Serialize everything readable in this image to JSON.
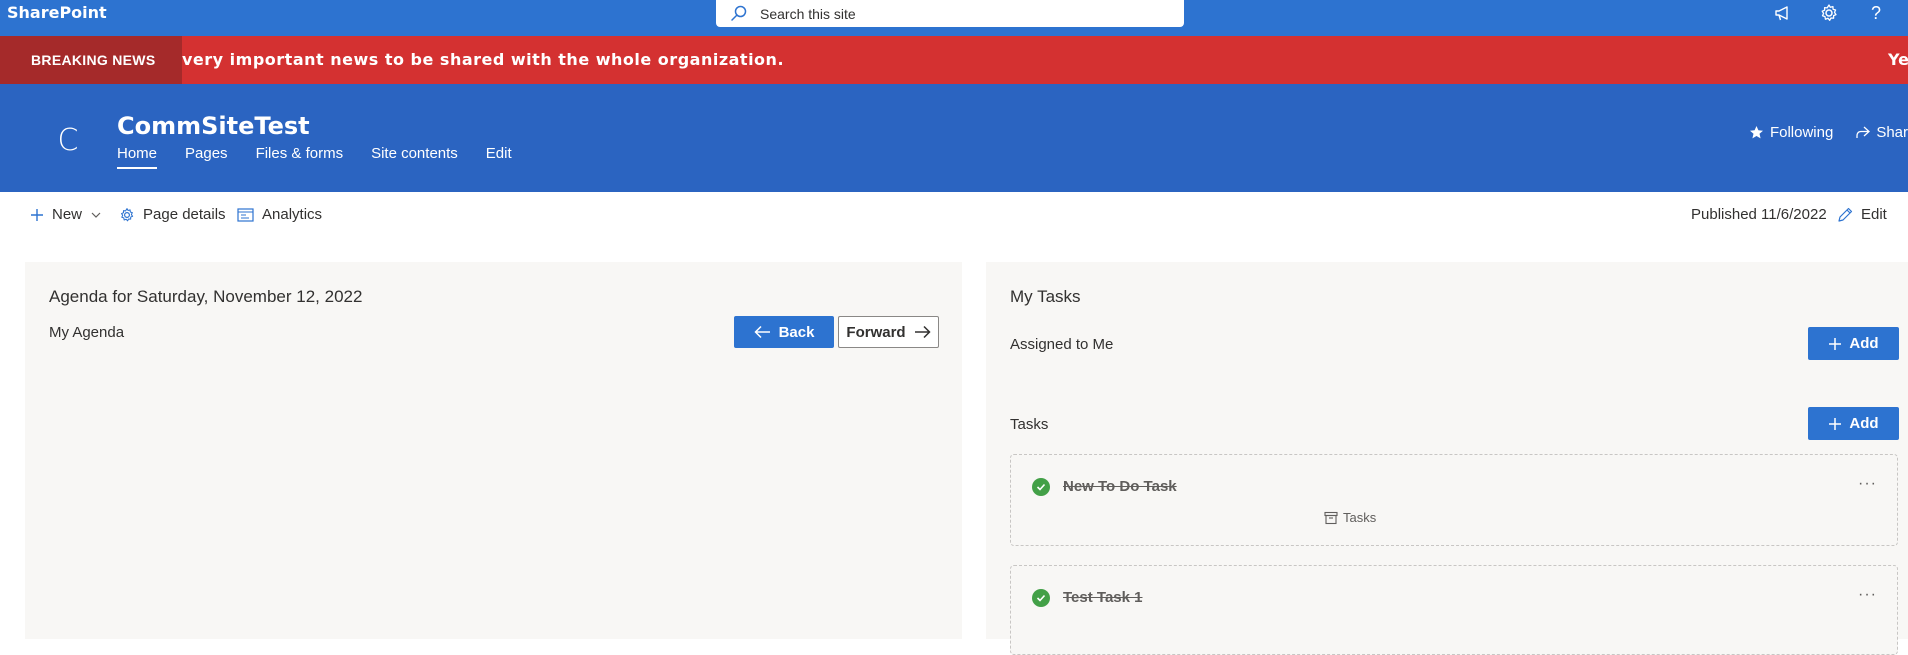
{
  "suite": {
    "app_name": "SharePoint",
    "search_placeholder": "Search this site"
  },
  "news": {
    "label": "BREAKING NEWS",
    "text": "very important news to be shared with the whole organization.",
    "text_next": "Ye"
  },
  "site": {
    "logo_letter": "C",
    "title": "CommSiteTest",
    "nav": [
      {
        "label": "Home"
      },
      {
        "label": "Pages"
      },
      {
        "label": "Files & forms"
      },
      {
        "label": "Site contents"
      },
      {
        "label": "Edit"
      }
    ],
    "following_label": "Following",
    "share_label": "Shar"
  },
  "commandbar": {
    "new_label": "New",
    "page_details_label": "Page details",
    "analytics_label": "Analytics",
    "published_label": "Published 11/6/2022",
    "edit_label": "Edit"
  },
  "agenda": {
    "title": "Agenda for Saturday, November 12, 2022",
    "subtitle": "My Agenda",
    "back_label": "Back",
    "forward_label": "Forward"
  },
  "tasks": {
    "title": "My Tasks",
    "assigned_label": "Assigned to Me",
    "tasks_label": "Tasks",
    "add_label": "Add",
    "items": [
      {
        "name": "New To Do Task",
        "bucket": "Tasks"
      },
      {
        "name": "Test Task 1"
      }
    ]
  },
  "colors": {
    "suite_blue": "#2d73d0",
    "header_blue": "#2b64c1",
    "news_red": "#d43131",
    "news_label_red": "#a52a2a",
    "check_green": "#43a047"
  }
}
